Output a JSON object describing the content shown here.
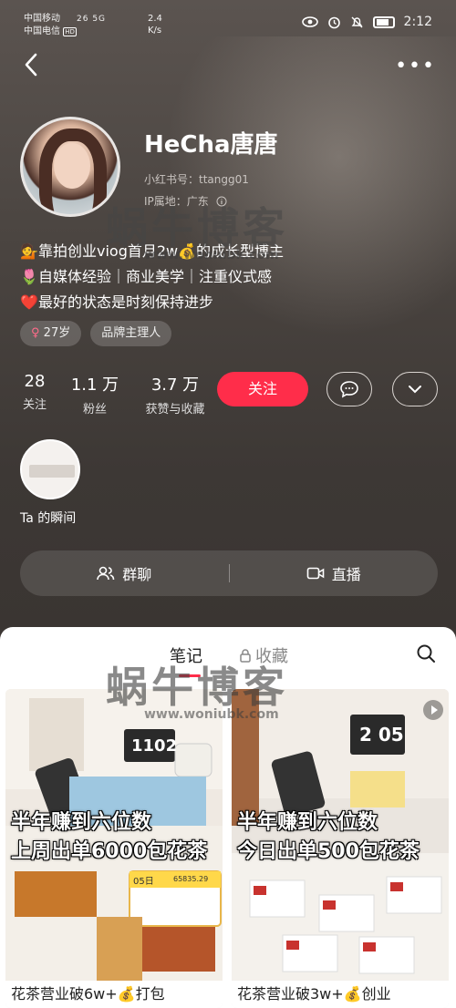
{
  "status_bar": {
    "carrier1": "中国移动",
    "carrier2": "中国电信",
    "hd": "HD",
    "signal": "26  5G",
    "speed_value": "2.4",
    "speed_unit": "K/s",
    "time": "2:12"
  },
  "profile": {
    "name": "HeCha唐唐",
    "account_id": "小红书号：ttangg01",
    "ip_location": "IP属地：广东",
    "bio": [
      {
        "icon": "💁",
        "text": "靠拍创业viog首月2w💰的成长型博主"
      },
      {
        "icon": "🌷",
        "text": "自媒体经验｜商业美学｜注重仪式感"
      },
      {
        "icon": "❤️",
        "text": "最好的状态是时刻保持进步"
      }
    ],
    "tags": [
      {
        "text": "27岁"
      },
      {
        "text": "品牌主理人"
      }
    ]
  },
  "stats": [
    {
      "value": "28",
      "label": "关注"
    },
    {
      "value": "1.1 万",
      "label": "粉丝"
    },
    {
      "value": "3.7 万",
      "label": "获赞与收藏"
    }
  ],
  "follow_label": "关注",
  "moment_label": "Ta 的瞬间",
  "actions": {
    "group_chat": "群聊",
    "live": "直播"
  },
  "tabs": {
    "notes": "笔记",
    "collections": "收藏"
  },
  "notes": [
    {
      "overlay_line1": "半年赚到六位数",
      "overlay_line2": "上周出单6000包花茶",
      "screen_text": "1102",
      "app_text": "05日",
      "app_amount": "65835.29",
      "title": "花茶营业破6w+💰打包"
    },
    {
      "overlay_line1": "半年赚到六位数",
      "overlay_line2": "今日出单500包花茶",
      "screen_text": "2 05",
      "title": "花茶营业破3w+💰创业"
    }
  ],
  "watermark": {
    "main": "蜗牛博客",
    "url": "www.woniubk.com"
  },
  "colors": {
    "accent": "#ff2d4a",
    "hero_bg": "#4a4440"
  }
}
